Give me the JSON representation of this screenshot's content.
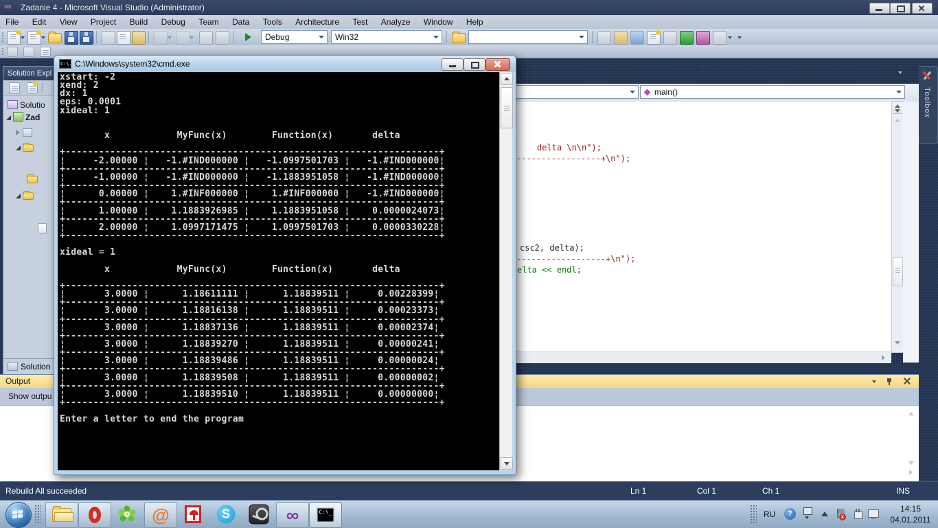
{
  "window": {
    "title": "Zadanie 4 - Microsoft Visual Studio (Administrator)"
  },
  "icons": {
    "vs_logo": "∞",
    "opera": "O",
    "mailru": "@",
    "skype": "S",
    "vs_taskbar": "∞",
    "cmd_glyph": "C:\\_",
    "cmd_title_glyph": "C:\\.",
    "help": "?"
  },
  "menu": {
    "items": [
      "File",
      "Edit",
      "View",
      "Project",
      "Build",
      "Debug",
      "Team",
      "Data",
      "Tools",
      "Architecture",
      "Test",
      "Analyze",
      "Window",
      "Help"
    ]
  },
  "toolbar": {
    "config": "Debug",
    "platform": "Win32"
  },
  "solution_explorer": {
    "title": "Solution Expl",
    "root_label": "Solutio",
    "project_label": "Zad",
    "bottom_tab": "Solution"
  },
  "editor": {
    "nav_function": "main()",
    "code_lines": [
      {
        "text": "delta \\n\\n\");"
      },
      {
        "text": "-----------------+\\n\");"
      },
      {
        "text": "csc2, delta);"
      },
      {
        "text": "------------------+\\n\");"
      },
      {
        "text": "elta << endl;"
      }
    ]
  },
  "toolbox": {
    "label": "Toolbox"
  },
  "output_panel": {
    "title": "Output",
    "show_label": "Show outpu"
  },
  "status_bar": {
    "message": "Rebuild All succeeded",
    "ln": "Ln 1",
    "col": "Col 1",
    "ch": "Ch 1",
    "mode": "INS"
  },
  "cmd": {
    "title": "C:\\Windows\\system32\\cmd.exe",
    "lines": [
      "xstart: -2",
      "xend: 2",
      "dx: 1",
      "eps: 0.0001",
      "xideal: 1",
      "",
      "",
      "        x            MyFunc(x)        Function(x)       delta",
      "",
      "+-------------------------------------------------------------------+",
      "¦     -2.00000 ¦   -1.#IND000000 ¦   -1.0997501703 ¦   -1.#IND000000¦",
      "+-------------------------------------------------------------------+",
      "¦     -1.00000 ¦   -1.#IND000000 ¦   -1.1883951058 ¦   -1.#IND000000¦",
      "+-------------------------------------------------------------------+",
      "¦      0.00000 ¦    1.#INF000000 ¦    1.#INF000000 ¦   -1.#IND000000¦",
      "+-------------------------------------------------------------------+",
      "¦      1.00000 ¦    1.1883926985 ¦    1.1883951058 ¦    0.0000024073¦",
      "+-------------------------------------------------------------------+",
      "¦      2.00000 ¦    1.0997171475 ¦    1.0997501703 ¦    0.0000330228¦",
      "+-------------------------------------------------------------------+",
      "",
      "xideal = 1",
      "",
      "        x            MyFunc(x)        Function(x)       delta",
      "",
      "+-------------------------------------------------------------------+",
      "¦       3.0000 ¦      1.18611111 ¦      1.18839511 ¦     0.00228399¦",
      "+-------------------------------------------------------------------+",
      "¦       3.0000 ¦      1.18816138 ¦      1.18839511 ¦     0.00023373¦",
      "+-------------------------------------------------------------------+",
      "¦       3.0000 ¦      1.18837136 ¦      1.18839511 ¦     0.00002374¦",
      "+-------------------------------------------------------------------+",
      "¦       3.0000 ¦      1.18839270 ¦      1.18839511 ¦     0.00000241¦",
      "+-------------------------------------------------------------------+",
      "¦       3.0000 ¦      1.18839486 ¦      1.18839511 ¦     0.00000024¦",
      "+-------------------------------------------------------------------+",
      "¦       3.0000 ¦      1.18839508 ¦      1.18839511 ¦     0.00000002¦",
      "+-------------------------------------------------------------------+",
      "¦       3.0000 ¦      1.18839510 ¦      1.18839511 ¦     0.00000000¦",
      "+-------------------------------------------------------------------+",
      "",
      "Enter a letter to end the program"
    ]
  },
  "tray": {
    "lang": "RU",
    "time": "14:15",
    "date": "04.01.2011"
  }
}
